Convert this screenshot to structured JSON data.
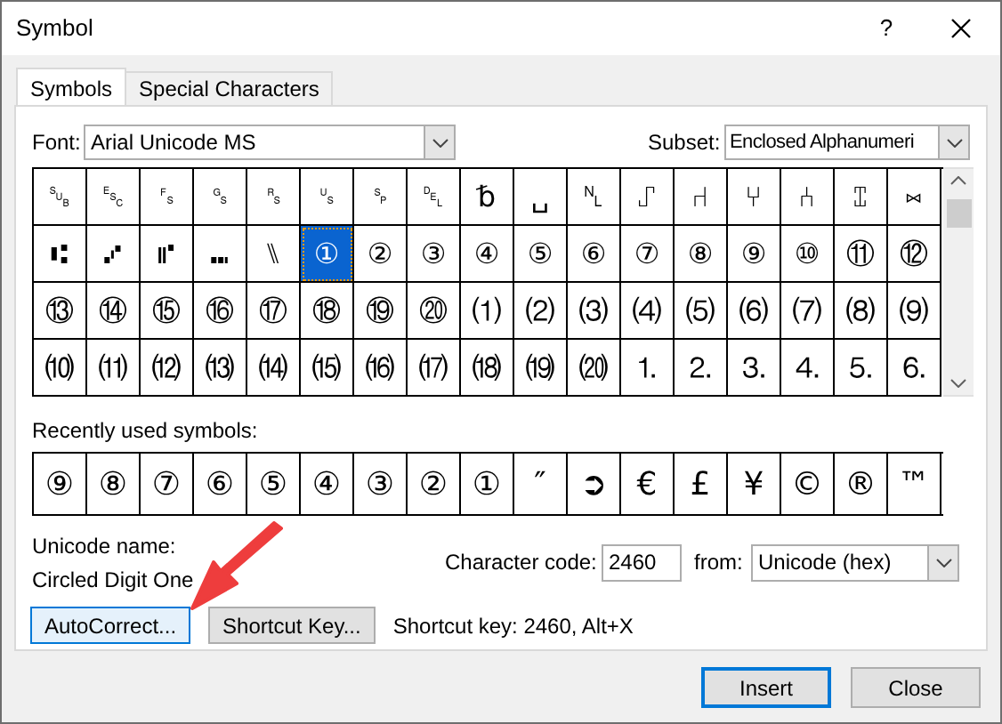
{
  "window": {
    "title": "Symbol",
    "help": "?"
  },
  "tabs": [
    {
      "label": "Symbols",
      "selected": true
    },
    {
      "label": "Special Characters",
      "selected": false
    }
  ],
  "font": {
    "label": "Font:",
    "value": "Arial Unicode MS"
  },
  "subset": {
    "label": "Subset:",
    "value": "Enclosed Alphanumeri"
  },
  "symbol_grid": {
    "rows": [
      [
        {
          "char": "␚",
          "selected": false
        },
        {
          "char": "␛",
          "selected": false
        },
        {
          "char": "␜",
          "selected": false
        },
        {
          "char": "␝",
          "selected": false
        },
        {
          "char": "␞",
          "selected": false
        },
        {
          "char": "␟",
          "selected": false
        },
        {
          "char": "␠",
          "selected": false
        },
        {
          "char": "␡",
          "selected": false
        },
        {
          "char": "␢",
          "selected": false
        },
        {
          "char": "␣",
          "selected": false
        },
        {
          "char": "␤",
          "selected": false
        },
        {
          "char": "⑀",
          "selected": false
        },
        {
          "char": "⑁",
          "selected": false
        },
        {
          "char": "⑂",
          "selected": false
        },
        {
          "char": "⑃",
          "selected": false
        },
        {
          "char": "⑄",
          "selected": false
        },
        {
          "char": "⑅",
          "selected": false
        }
      ],
      [
        {
          "char": "⑆",
          "selected": false
        },
        {
          "char": "⑇",
          "selected": false
        },
        {
          "char": "⑈",
          "selected": false
        },
        {
          "char": "⑉",
          "selected": false
        },
        {
          "char": "⑊",
          "selected": false
        },
        {
          "char": "①",
          "selected": true
        },
        {
          "char": "②",
          "selected": false
        },
        {
          "char": "③",
          "selected": false
        },
        {
          "char": "④",
          "selected": false
        },
        {
          "char": "⑤",
          "selected": false
        },
        {
          "char": "⑥",
          "selected": false
        },
        {
          "char": "⑦",
          "selected": false
        },
        {
          "char": "⑧",
          "selected": false
        },
        {
          "char": "⑨",
          "selected": false
        },
        {
          "char": "⑩",
          "selected": false
        },
        {
          "char": "⑪",
          "selected": false
        },
        {
          "char": "⑫",
          "selected": false
        }
      ],
      [
        {
          "char": "⑬",
          "selected": false
        },
        {
          "char": "⑭",
          "selected": false
        },
        {
          "char": "⑮",
          "selected": false
        },
        {
          "char": "⑯",
          "selected": false
        },
        {
          "char": "⑰",
          "selected": false
        },
        {
          "char": "⑱",
          "selected": false
        },
        {
          "char": "⑲",
          "selected": false
        },
        {
          "char": "⑳",
          "selected": false
        },
        {
          "char": "⑴",
          "selected": false
        },
        {
          "char": "⑵",
          "selected": false
        },
        {
          "char": "⑶",
          "selected": false
        },
        {
          "char": "⑷",
          "selected": false
        },
        {
          "char": "⑸",
          "selected": false
        },
        {
          "char": "⑹",
          "selected": false
        },
        {
          "char": "⑺",
          "selected": false
        },
        {
          "char": "⑻",
          "selected": false
        },
        {
          "char": "⑼",
          "selected": false
        }
      ],
      [
        {
          "char": "⑽",
          "selected": false
        },
        {
          "char": "⑾",
          "selected": false
        },
        {
          "char": "⑿",
          "selected": false
        },
        {
          "char": "⒀",
          "selected": false
        },
        {
          "char": "⒁",
          "selected": false
        },
        {
          "char": "⒂",
          "selected": false
        },
        {
          "char": "⒃",
          "selected": false
        },
        {
          "char": "⒄",
          "selected": false
        },
        {
          "char": "⒅",
          "selected": false
        },
        {
          "char": "⒆",
          "selected": false
        },
        {
          "char": "⒇",
          "selected": false
        },
        {
          "char": "⒈",
          "selected": false
        },
        {
          "char": "⒉",
          "selected": false
        },
        {
          "char": "⒊",
          "selected": false
        },
        {
          "char": "⒋",
          "selected": false
        },
        {
          "char": "⒌",
          "selected": false
        },
        {
          "char": "⒍",
          "selected": false
        }
      ]
    ]
  },
  "recently_used": {
    "label": "Recently used symbols:",
    "symbols": [
      "⑨",
      "⑧",
      "⑦",
      "⑥",
      "⑤",
      "④",
      "③",
      "②",
      "①",
      "″",
      "➲",
      "€",
      "£",
      "¥",
      "©",
      "®",
      "™"
    ]
  },
  "unicode_name": {
    "label": "Unicode name:",
    "value": "Circled Digit One"
  },
  "character_code": {
    "label": "Character code:",
    "value": "2460"
  },
  "from": {
    "label": "from:",
    "value": "Unicode (hex)"
  },
  "buttons": [
    {
      "label": "AutoCorrect...",
      "focused": true
    },
    {
      "label": "Shortcut Key...",
      "focused": false
    }
  ],
  "shortcut_key": "Shortcut key: 2460, Alt+X",
  "footer_buttons": [
    {
      "label": "Insert",
      "default": true
    },
    {
      "label": "Close",
      "default": false
    }
  ]
}
